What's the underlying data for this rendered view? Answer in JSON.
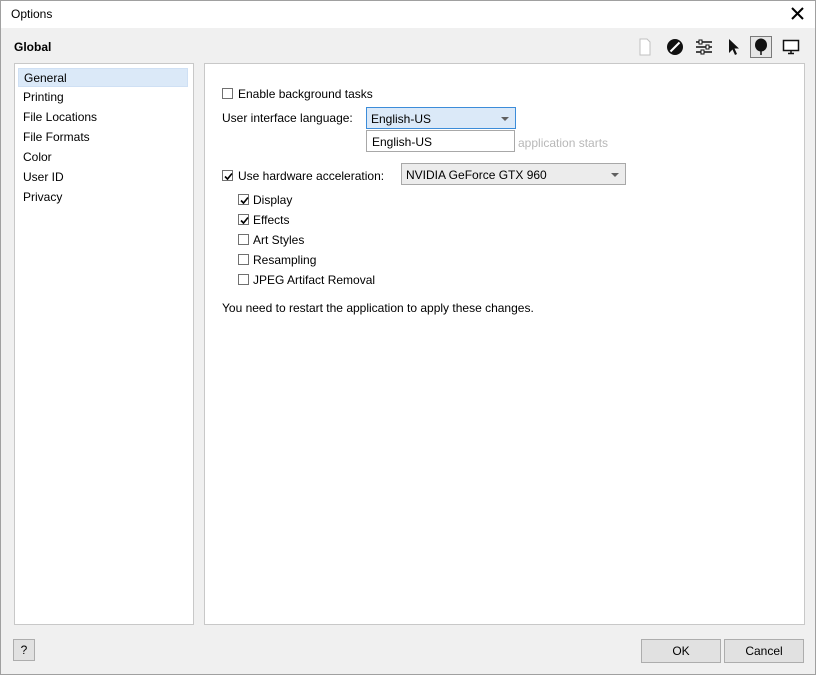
{
  "window": {
    "title": "Options"
  },
  "toolbar": {
    "section_title": "Global",
    "icons": [
      "page-icon",
      "no-entry-icon",
      "sliders-icon",
      "pointer-icon",
      "balloon-icon",
      "monitor-icon"
    ]
  },
  "nav": {
    "items": [
      {
        "label": "General",
        "selected": true
      },
      {
        "label": "Printing"
      },
      {
        "label": "File Locations"
      },
      {
        "label": "File Formats"
      },
      {
        "label": "Color"
      },
      {
        "label": "User ID"
      },
      {
        "label": "Privacy"
      }
    ]
  },
  "general": {
    "background_tasks": {
      "label": "Enable background tasks",
      "checked": false
    },
    "ui_language": {
      "label": "User interface language:",
      "value": "English-US",
      "options": [
        "English-US"
      ],
      "hidden_hint": "application starts"
    },
    "hw_accel": {
      "label": "Use hardware acceleration:",
      "checked": true,
      "gpu": "NVIDIA GeForce GTX 960"
    },
    "sub_options": [
      {
        "label": "Display",
        "checked": true
      },
      {
        "label": "Effects",
        "checked": true
      },
      {
        "label": "Art Styles",
        "checked": false
      },
      {
        "label": "Resampling",
        "checked": false
      },
      {
        "label": "JPEG Artifact Removal",
        "checked": false
      }
    ],
    "restart_note": "You need to restart the application to apply these changes."
  },
  "footer": {
    "help_label": "?",
    "ok_label": "OK",
    "cancel_label": "Cancel"
  },
  "colors": {
    "selection": "#dbe9f8",
    "focus_border": "#3c8cd9"
  }
}
